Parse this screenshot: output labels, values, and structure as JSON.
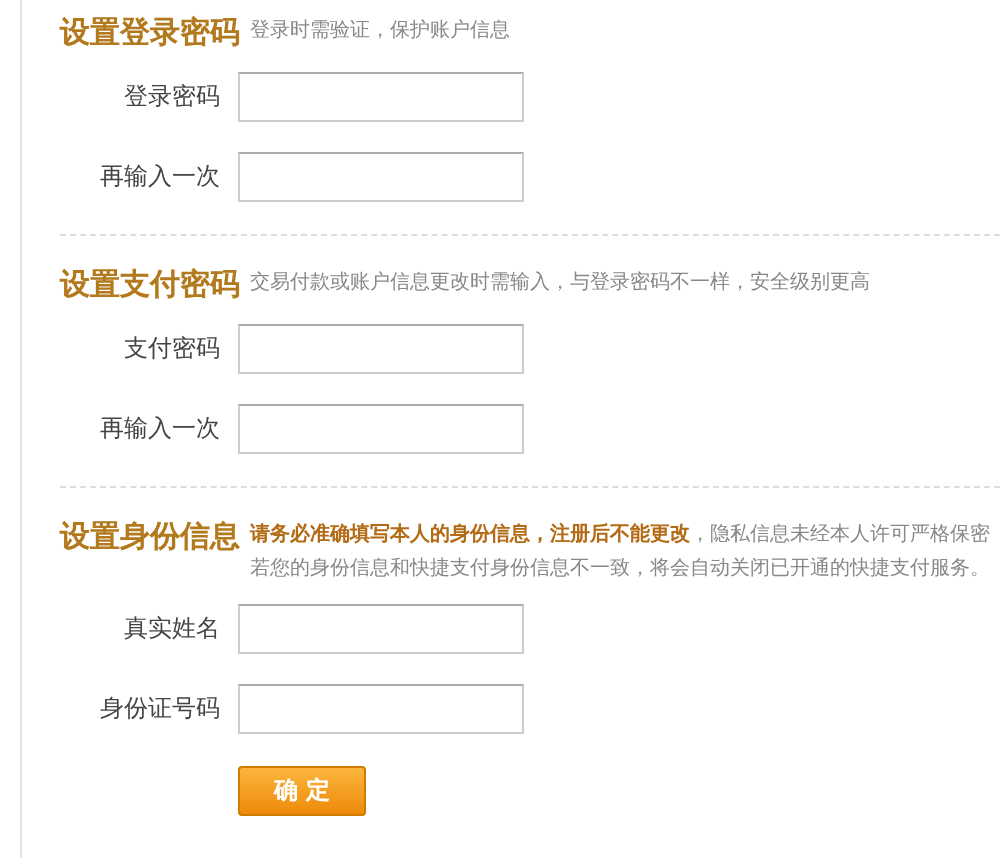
{
  "sections": [
    {
      "title": "设置登录密码",
      "notes": [
        "登录时需验证，保护账户信息"
      ],
      "fields": [
        {
          "label": "登录密码"
        },
        {
          "label": "再输入一次"
        }
      ]
    },
    {
      "title": "设置支付密码",
      "notes": [
        "交易付款或账户信息更改时需输入，与登录密码不一样，安全级别更高"
      ],
      "fields": [
        {
          "label": "支付密码"
        },
        {
          "label": "再输入一次"
        }
      ]
    },
    {
      "title": "设置身份信息",
      "notes": [
        "**请务必准确填写本人的身份信息，注册后不能更改**，隐私信息未经本人许可严格保密",
        "若您的身份信息和快捷支付身份信息不一致，将会自动关闭已开通的快捷支付服务。"
      ],
      "fields": [
        {
          "label": "真实姓名"
        },
        {
          "label": "身份证号码"
        }
      ]
    }
  ],
  "submit": "确 定"
}
